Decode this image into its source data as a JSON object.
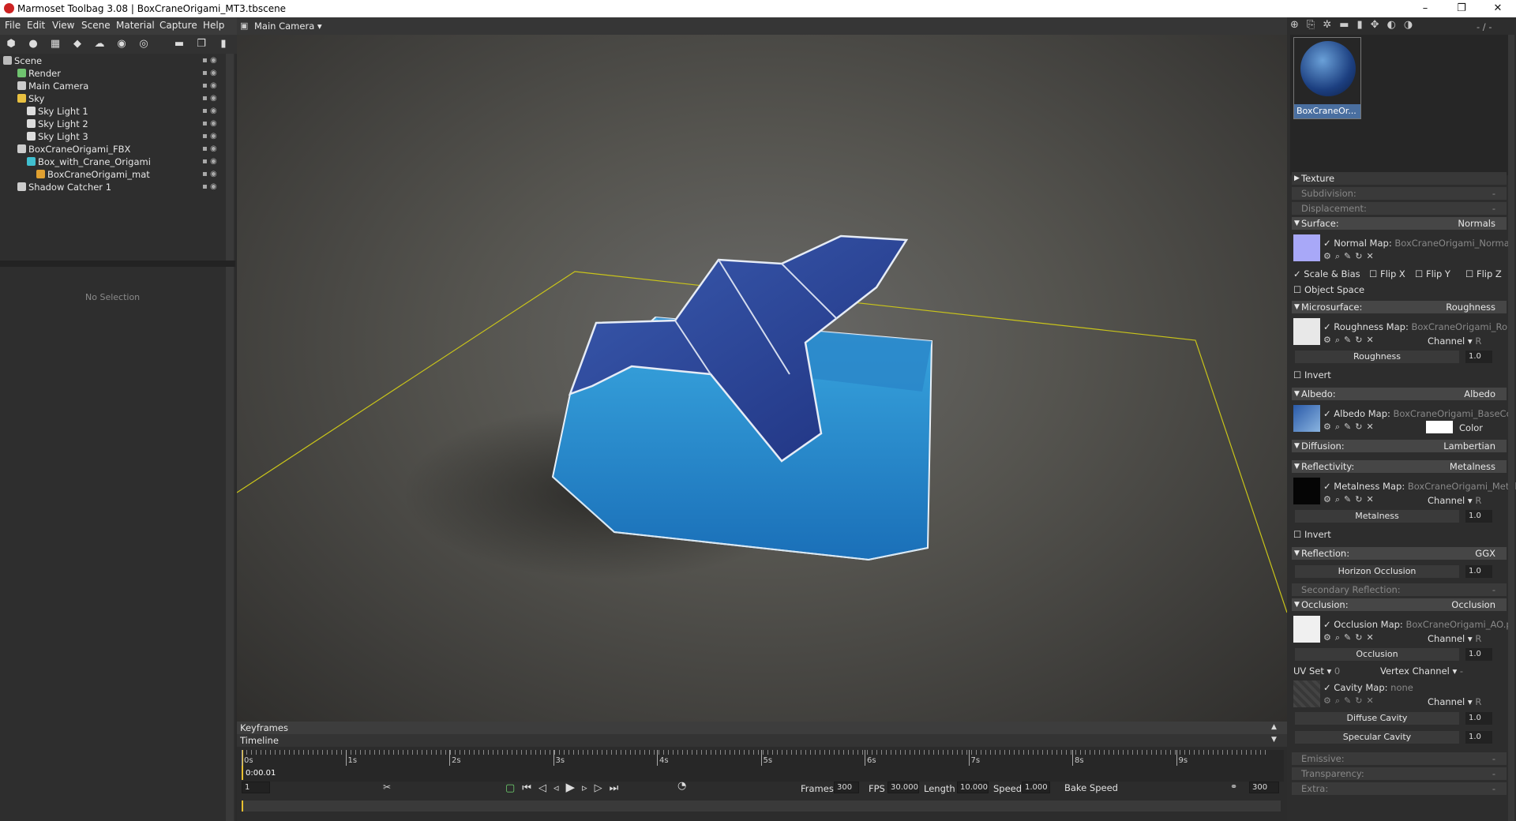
{
  "window": {
    "title": "Marmoset Toolbag 3.08  |  BoxCraneOrigami_MT3.tbscene",
    "min": "–",
    "restore": "❐",
    "close": "✕"
  },
  "menu": [
    "File",
    "Edit",
    "View",
    "Scene",
    "Material",
    "Capture",
    "Help"
  ],
  "viewport": {
    "camera": "Main Camera ▾"
  },
  "scene_tree": [
    {
      "label": "Scene",
      "indent": 0,
      "color": "#bbb"
    },
    {
      "label": "Render",
      "indent": 1,
      "color": "#6fc36f"
    },
    {
      "label": "Main Camera",
      "indent": 1,
      "color": "#ccc"
    },
    {
      "label": "Sky",
      "indent": 1,
      "color": "#e8c040"
    },
    {
      "label": "Sky Light 1",
      "indent": 2,
      "color": "#ddd"
    },
    {
      "label": "Sky Light 2",
      "indent": 2,
      "color": "#ddd"
    },
    {
      "label": "Sky Light 3",
      "indent": 2,
      "color": "#ddd"
    },
    {
      "label": "BoxCraneOrigami_FBX",
      "indent": 1,
      "color": "#ccc"
    },
    {
      "label": "Box_with_Crane_Origami",
      "indent": 2,
      "color": "#40c0d0"
    },
    {
      "label": "BoxCraneOrigami_mat",
      "indent": 3,
      "color": "#e0a030"
    },
    {
      "label": "Shadow Catcher 1",
      "indent": 1,
      "color": "#ccc"
    }
  ],
  "properties": {
    "empty": "No Selection"
  },
  "timeline": {
    "keyframes": "Keyframes",
    "timeline": "Timeline",
    "ticks": [
      "0s",
      "1s",
      "2s",
      "3s",
      "4s",
      "5s",
      "6s",
      "7s",
      "8s",
      "9s"
    ],
    "current": "0:00.01",
    "frame": "1",
    "frames_label": "Frames",
    "frames": "300",
    "fps_label": "FPS",
    "fps": "30.000",
    "length_label": "Length",
    "length": "10.000",
    "speed_label": "Speed",
    "speed": "1.000",
    "bake": "Bake Speed",
    "end": "300"
  },
  "material": {
    "name": "BoxCraneOr...",
    "zoom": "- / -",
    "texture": "Texture",
    "subdivision": "Subdivision:",
    "displacement": "Displacement:",
    "surface": "Surface:",
    "surface_val": "Normals",
    "normal_map": "Normal Map:",
    "normal_file": "BoxCraneOrigami_Normal.",
    "scale_bias": "Scale & Bias",
    "flipx": "Flip X",
    "flipy": "Flip Y",
    "flipz": "Flip Z",
    "object_space": "Object Space",
    "micro": "Microsurface:",
    "micro_val": "Roughness",
    "rough_map": "Roughness Map:",
    "rough_file": "BoxCraneOrigami_Rou",
    "channel": "Channel ▾",
    "ch_r": "R",
    "roughness": "Roughness",
    "roughness_v": "1.0",
    "invert": "Invert",
    "albedo": "Albedo:",
    "albedo_val": "Albedo",
    "albedo_map": "Albedo Map:",
    "albedo_file": "BoxCraneOrigami_BaseCol",
    "color": "Color",
    "diffusion": "Diffusion:",
    "diffusion_val": "Lambertian",
    "reflectivity": "Reflectivity:",
    "reflectivity_val": "Metalness",
    "metal_map": "Metalness Map:",
    "metal_file": "BoxCraneOrigami_Metal",
    "metalness": "Metalness",
    "metalness_v": "1.0",
    "reflection": "Reflection:",
    "reflection_val": "GGX",
    "horizon": "Horizon Occlusion",
    "horizon_v": "1.0",
    "secondary": "Secondary Reflection:",
    "occlusion": "Occlusion:",
    "occlusion_val": "Occlusion",
    "occ_map": "Occlusion Map:",
    "occ_file": "BoxCraneOrigami_AO.p",
    "occ": "Occlusion",
    "occ_v": "1.0",
    "uvset": "UV Set ▾",
    "uv0": "0",
    "vertex_channel": "Vertex Channel ▾",
    "cavity_map": "Cavity Map:",
    "cavity_file": "none",
    "diffuse_cav": "Diffuse Cavity",
    "diffuse_cav_v": "1.0",
    "specular_cav": "Specular Cavity",
    "specular_cav_v": "1.0",
    "emissive": "Emissive:",
    "transparency": "Transparency:",
    "extra": "Extra:",
    "dash": "-"
  }
}
